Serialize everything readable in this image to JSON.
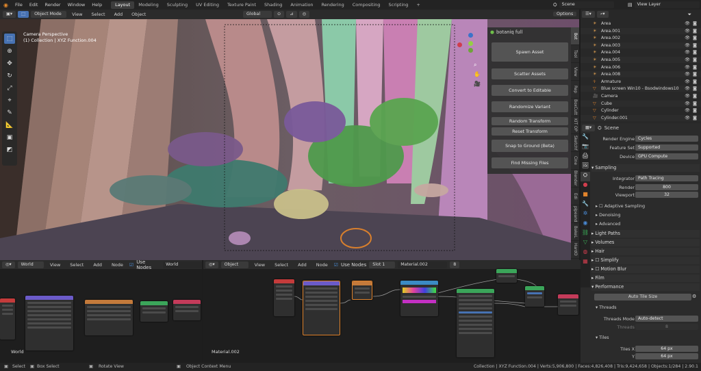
{
  "topbar": {
    "menus": [
      "File",
      "Edit",
      "Render",
      "Window",
      "Help"
    ],
    "workspaces": [
      "Layout",
      "Modeling",
      "Sculpting",
      "UV Editing",
      "Texture Paint",
      "Shading",
      "Animation",
      "Rendering",
      "Compositing",
      "Scripting"
    ],
    "active_workspace": "Layout",
    "add_tab": "+",
    "scene": "Scene",
    "view_layer": "View Layer"
  },
  "viewport": {
    "mode": "Object Mode",
    "menus": [
      "View",
      "Select",
      "Add",
      "Object"
    ],
    "orientation": "Global",
    "collection_filter": "Models",
    "options": "Options",
    "overlay_title": "Camera Perspective",
    "overlay_sub": "(1) Collection | XYZ Function.004"
  },
  "botaniq": {
    "title": "botaniq full",
    "buttons": [
      "Spawn Asset",
      "Scatter Assets",
      "Convert to Editable",
      "Randomize Variant",
      "Random Transform",
      "Reset Transform",
      "Snap to Ground (Beta)",
      "Find Missing Files"
    ]
  },
  "ntabs": [
    "Bot",
    "Tool",
    "View",
    "Rep",
    "BoxCutt",
    "KIT OP",
    "Sketchf",
    "Cine",
    "Blender",
    "Edi",
    "pipeand",
    "BakeL",
    "HardO",
    "Item"
  ],
  "outliner": {
    "search_placeholder": "",
    "items": [
      "Area",
      "Area.001",
      "Area.002",
      "Area.003",
      "Area.004",
      "Area.005",
      "Area.006",
      "Area.008",
      "Armature",
      "Blue screen Win10 - Bsodwindows10",
      "Camera",
      "Cube",
      "Cylinder",
      "Cylinder.001"
    ]
  },
  "properties": {
    "title": "Scene",
    "render_engine_label": "Render Engine",
    "render_engine": "Cycles",
    "feature_set_label": "Feature Set",
    "feature_set": "Supported",
    "device_label": "Device",
    "device": "GPU Compute",
    "sampling": "Sampling",
    "integrator_label": "Integrator",
    "integrator": "Path Tracing",
    "render_label": "Render",
    "render_samples": "800",
    "viewport_label": "Viewport",
    "viewport_samples": "32",
    "adaptive": "Adaptive Sampling",
    "denoising": "Denoising",
    "advanced": "Advanced",
    "light_paths": "Light Paths",
    "volumes": "Volumes",
    "hair": "Hair",
    "simplify": "Simplify",
    "motion_blur": "Motion Blur",
    "film": "Film",
    "performance": "Performance",
    "auto_tile": "Auto Tile Size",
    "threads": "Threads",
    "threads_mode_label": "Threads Mode",
    "threads_mode": "Auto-detect",
    "threads_label": "Threads",
    "threads_value": "8",
    "tiles": "Tiles",
    "tiles_x_label": "Tiles X",
    "tiles_x": "64 px",
    "tiles_y_label": "Y",
    "tiles_y": "64 px"
  },
  "node_left": {
    "type": "World",
    "menus": [
      "View",
      "Select",
      "Add",
      "Node"
    ],
    "use_nodes": "Use Nodes",
    "datablock": "World",
    "label": "World"
  },
  "node_right": {
    "type": "Object",
    "menus": [
      "View",
      "Select",
      "Add",
      "Node"
    ],
    "use_nodes": "Use Nodes",
    "slot": "Slot 1",
    "material": "Material.002",
    "users": "8",
    "label": "Material.002"
  },
  "status": {
    "select": "Select",
    "box_select": "Box Select",
    "rotate": "Rotate View",
    "context": "Object Context Menu",
    "stats": "Collection | XYZ Function.004 | Verts:5,906,800 | Faces:4,826,408 | Tris:9,424,658 | Objects:1/284 | 2.90.1"
  },
  "colors": {
    "accent": "#4772b3",
    "orange": "#e0832c",
    "green": "#3cb45a"
  }
}
